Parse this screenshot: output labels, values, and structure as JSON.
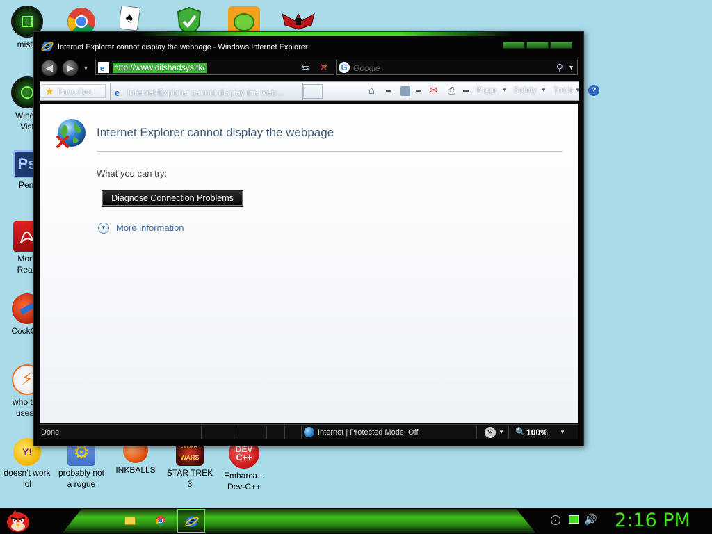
{
  "desktop": {
    "icons": [
      {
        "label": "mista",
        "icon": "recycle-icon"
      },
      {
        "label": "Windo\nVist",
        "icon": "recycle-icon"
      },
      {
        "label": "Peni",
        "icon": "photoshop-icon"
      },
      {
        "label": "Morb\nRead",
        "icon": "pdf-reader-icon"
      },
      {
        "label": "CockCle",
        "icon": "ccleaner-icon"
      },
      {
        "label": "who the\nuses t",
        "icon": "avast-icon"
      },
      {
        "label": "doesn't work\nlol",
        "icon": "yahoo-messenger-icon"
      },
      {
        "label": "probably not\na rogue",
        "icon": "gears-icon"
      },
      {
        "label": "INKBALLS",
        "icon": "inkball-icon"
      },
      {
        "label": "STAR TREK\n3",
        "icon": "star-trek-icon"
      },
      {
        "label": "Embarca...\nDev-C++",
        "icon": "devcpp-icon"
      }
    ],
    "devcpp_icon_text": "DEV\nC++"
  },
  "window": {
    "title": "Internet Explorer cannot display the webpage - Windows Internet Explorer",
    "address": "http://www.dilshadsys.tk/",
    "search_placeholder": "Google",
    "favorites_label": "Favorites",
    "tab_label": "Internet Explorer cannot display the web...",
    "commands": {
      "page": "Page",
      "safety": "Safety",
      "tools": "Tools"
    }
  },
  "content": {
    "title": "Internet Explorer cannot display the webpage",
    "try_text": "What you can try:",
    "diagnose_button": "Diagnose Connection Problems",
    "more_info": "More information"
  },
  "statusbar": {
    "status": "Done",
    "zone": "Internet | Protected Mode: Off",
    "zoom": "100%"
  },
  "taskbar": {
    "clock": "2:16 PM"
  },
  "colors": {
    "accent_green": "#42e31c",
    "desktop": "#a9dbe9",
    "link_blue": "#3c6da6"
  }
}
